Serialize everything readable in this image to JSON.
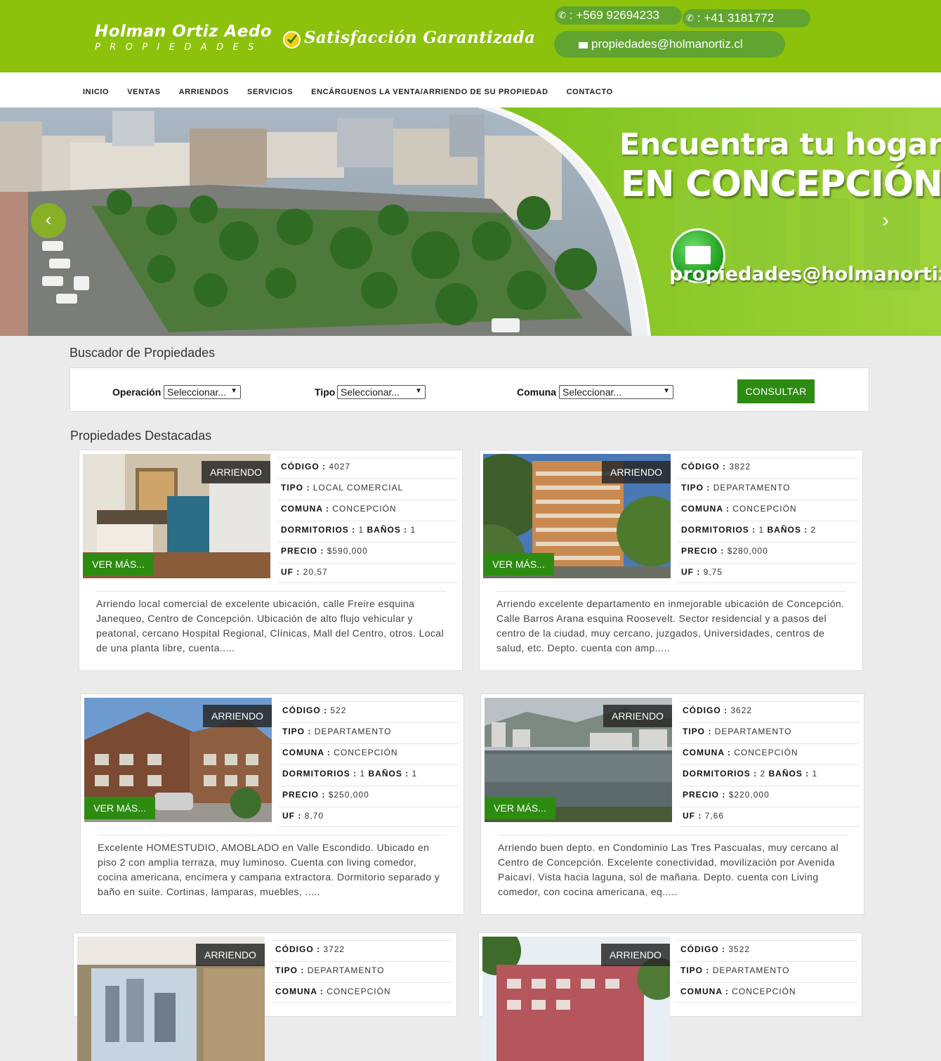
{
  "header": {
    "logo_line1": "Holman Ortiz Aedo",
    "logo_line2": "PROPIEDADES",
    "slogan": "Satisfacción Garantizada",
    "phone1": ": +569 92694233",
    "phone2": ": +41 3181772",
    "email": "propiedades@holmanortiz.cl",
    "brand_color": "#8cc20b",
    "accent_color": "#2e8b12"
  },
  "nav": {
    "items": [
      {
        "label": "INICIO"
      },
      {
        "label": "VENTAS"
      },
      {
        "label": "ARRIENDOS"
      },
      {
        "label": "SERVICIOS"
      },
      {
        "label": "ENCÁRGUENOS LA VENTA/ARRIENDO DE SU PROPIEDAD"
      },
      {
        "label": "CONTACTO"
      }
    ]
  },
  "hero": {
    "line1": "Encuentra tu hogar",
    "line2": "EN CONCEPCIÓN",
    "email": "propiedades@holmanortiz.cl",
    "prev_icon": "‹",
    "next_icon": "›"
  },
  "search": {
    "title": "Buscador de Propiedades",
    "operacion_label": "Operación",
    "operacion_value": "Seleccionar...",
    "tipo_label": "Tipo",
    "tipo_value": "Seleccionar...",
    "comuna_label": "Comuna",
    "comuna_value": "Seleccionar...",
    "button": "CONSULTAR"
  },
  "featured": {
    "title": "Propiedades Destacadas",
    "labels": {
      "codigo": "CÓDIGO :",
      "tipo": "TIPO :",
      "comuna": "COMUNA :",
      "dormitorios": "DORMITORIOS :",
      "banos": "BAÑOS :",
      "precio": "PRECIO :",
      "uf": "UF :",
      "ver_mas": "VER MÁS..."
    },
    "properties": [
      {
        "badge": "ARRIENDO",
        "codigo": "4027",
        "tipo": "LOCAL COMERCIAL",
        "comuna": "CONCEPCIÓN",
        "dormitorios": "1",
        "banos": "1",
        "precio": "$590,000",
        "uf": "20,57",
        "desc": "Arriendo local comercial de excelente ubicación, calle Freire esquina Janequeo, Centro de Concepción. Ubicación de alto flujo vehicular y peatonal, cercano Hospital Regional, Clínicas, Mall del Centro, otros. Local de una planta libre, cuenta....."
      },
      {
        "badge": "ARRIENDO",
        "codigo": "3822",
        "tipo": "DEPARTAMENTO",
        "comuna": "CONCEPCIÓN",
        "dormitorios": "1",
        "banos": "2",
        "precio": "$280,000",
        "uf": "9,75",
        "desc": "Arriendo excelente departamento en inmejorable ubicación de Concepción. Calle Barros Arana esquina Roosevelt. Sector residencial y a pasos del centro de la ciudad, muy cercano, juzgados, Universidades, centros de salud, etc. Depto. cuenta con amp....."
      },
      {
        "badge": "ARRIENDO",
        "codigo": "522",
        "tipo": "DEPARTAMENTO",
        "comuna": "CONCEPCIÓN",
        "dormitorios": "1",
        "banos": "1",
        "precio": "$250,000",
        "uf": "8,70",
        "desc": "Excelente HOMESTUDIO, AMOBLADO en Valle Escondido. Ubicado en piso 2 con amplia terraza, muy luminoso. Cuenta con living comedor, cocina americana, encimera y campana extractora. Dormitorio separado y baño en suite. Cortinas, lamparas, muebles, ....."
      },
      {
        "badge": "ARRIENDO",
        "codigo": "3622",
        "tipo": "DEPARTAMENTO",
        "comuna": "CONCEPCIÓN",
        "dormitorios": "2",
        "banos": "1",
        "precio": "$220,000",
        "uf": "7,66",
        "desc": "Arriendo buen depto. en Condominio Las Tres Pascualas, muy cercano al Centro de Concepción. Excelente conectividad, movilización por Avenida Paicaví. Vista hacia laguna, sol de mañana. Depto. cuenta con Living comedor, con cocina americana, eq....."
      },
      {
        "badge": "ARRIENDO",
        "codigo": "3722",
        "tipo": "DEPARTAMENTO",
        "comuna": "CONCEPCIÓN"
      },
      {
        "badge": "ARRIENDO",
        "codigo": "3522",
        "tipo": "DEPARTAMENTO",
        "comuna": "CONCEPCIÓN"
      }
    ]
  }
}
